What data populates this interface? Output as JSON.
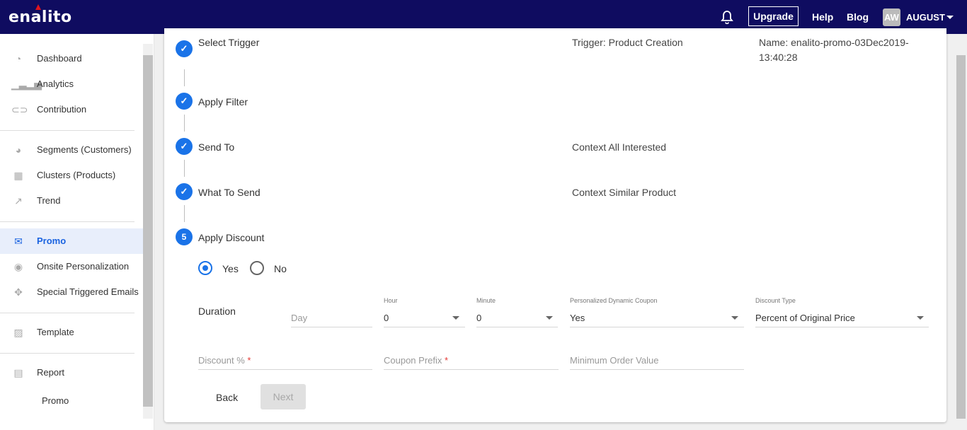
{
  "header": {
    "logo": "enalito",
    "upgrade": "Upgrade",
    "help": "Help",
    "blog": "Blog",
    "avatar": "AW",
    "user": "AUGUST",
    "brand_color": "#0f0c60",
    "accent": "#1a73e8"
  },
  "sidebar": {
    "items": [
      {
        "label": "Dashboard",
        "icon": "dashboard-icon"
      },
      {
        "label": "Analytics",
        "icon": "bar-chart-icon"
      },
      {
        "label": "Contribution",
        "icon": "handshake-icon"
      },
      {
        "label": "Segments (Customers)",
        "icon": "pie-chart-icon"
      },
      {
        "label": "Clusters (Products)",
        "icon": "grid-icon"
      },
      {
        "label": "Trend",
        "icon": "trend-icon"
      },
      {
        "label": "Promo",
        "icon": "envelope-icon",
        "active": true
      },
      {
        "label": "Onsite Personalization",
        "icon": "eye-icon"
      },
      {
        "label": "Special Triggered Emails",
        "icon": "crosshair-icon"
      },
      {
        "label": "Template",
        "icon": "image-icon"
      },
      {
        "label": "Report",
        "icon": "document-icon"
      },
      {
        "label": "Promo"
      }
    ]
  },
  "steps": [
    {
      "label": "Select Trigger",
      "summary": "Trigger: Product Creation",
      "extra": "Name: enalito-promo-03Dec2019-",
      "extra2": "13:40:28"
    },
    {
      "label": "Apply Filter"
    },
    {
      "label": "Send To",
      "summary": "Context All Interested"
    },
    {
      "label": "What To Send",
      "summary": "Context Similar Product"
    },
    {
      "label": "Apply Discount",
      "number": "5"
    }
  ],
  "form": {
    "yes": "Yes",
    "no": "No",
    "selected": "Yes",
    "duration": "Duration",
    "day_placeholder": "Day",
    "hour_label": "Hour",
    "hour_value": "0",
    "minute_label": "Minute",
    "minute_value": "0",
    "coupon_label": "Personalized Dynamic Coupon",
    "coupon_value": "Yes",
    "dtype_label": "Discount Type",
    "dtype_value": "Percent of Original Price",
    "discount_placeholder": "Discount %",
    "coupon_prefix_placeholder": "Coupon Prefix",
    "min_order_placeholder": "Minimum Order Value",
    "required_mark": "*",
    "back": "Back",
    "next": "Next"
  }
}
